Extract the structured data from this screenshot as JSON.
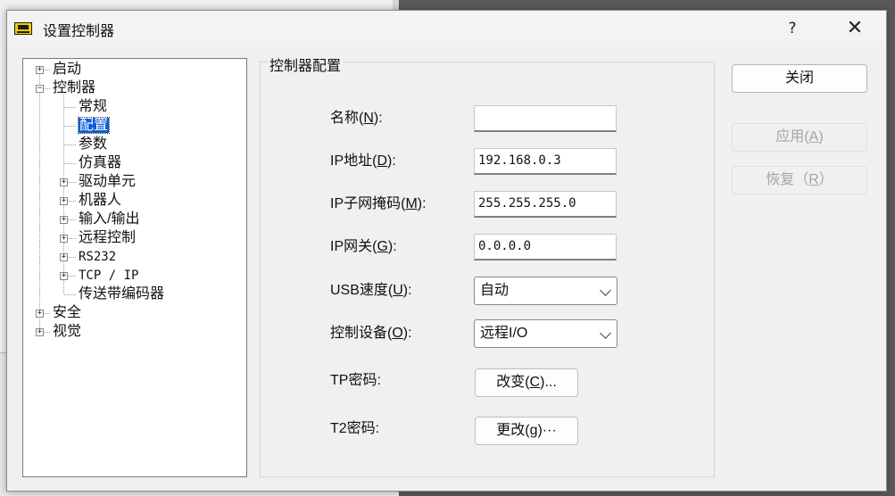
{
  "dialog": {
    "title": "设置控制器",
    "help_label": "?",
    "close_label": "✕"
  },
  "tree": {
    "items": [
      {
        "label": "启动",
        "expander": "+"
      },
      {
        "label": "控制器",
        "expander": "−"
      },
      {
        "label": "常规"
      },
      {
        "label": "配置",
        "selected": true
      },
      {
        "label": "参数"
      },
      {
        "label": "仿真器"
      },
      {
        "label": "驱动单元",
        "expander": "+"
      },
      {
        "label": "机器人",
        "expander": "+"
      },
      {
        "label": "输入/输出",
        "expander": "+"
      },
      {
        "label": "远程控制",
        "expander": "+"
      },
      {
        "label": "RS232",
        "expander": "+"
      },
      {
        "label": "TCP / IP",
        "expander": "+"
      },
      {
        "label": "传送带编码器"
      },
      {
        "label": "安全",
        "expander": "+"
      },
      {
        "label": "视觉",
        "expander": "+"
      }
    ]
  },
  "config": {
    "group_title": "控制器配置",
    "name": {
      "label": "名称",
      "key": "N",
      "suffix": ":",
      "value": ""
    },
    "ip": {
      "label": "IP地址",
      "key": "D",
      "suffix": ":",
      "value": "192.168.0.3"
    },
    "subnet": {
      "label": "IP子网掩码",
      "key": "M",
      "suffix": ":",
      "value": "255.255.255.0"
    },
    "gateway": {
      "label": "IP网关",
      "key": "G",
      "suffix": ":",
      "value": "0.0.0.0"
    },
    "usb": {
      "label": "USB速度",
      "key": "U",
      "suffix": ":",
      "value": "自动"
    },
    "control": {
      "label": "控制设备",
      "key": "O",
      "suffix": ":",
      "value": "远程I/O"
    },
    "tp": {
      "label": "TP密码:",
      "button_prefix": "改变",
      "button_key": "C",
      "button_suffix": "..."
    },
    "t2": {
      "label": "T2密码:",
      "button_prefix": "更改",
      "button_key": "g",
      "button_suffix": "···"
    }
  },
  "side_buttons": {
    "close": "关闭",
    "apply": {
      "prefix": "应用",
      "key": "A"
    },
    "restore": {
      "prefix": "恢复",
      "key": "R"
    }
  }
}
